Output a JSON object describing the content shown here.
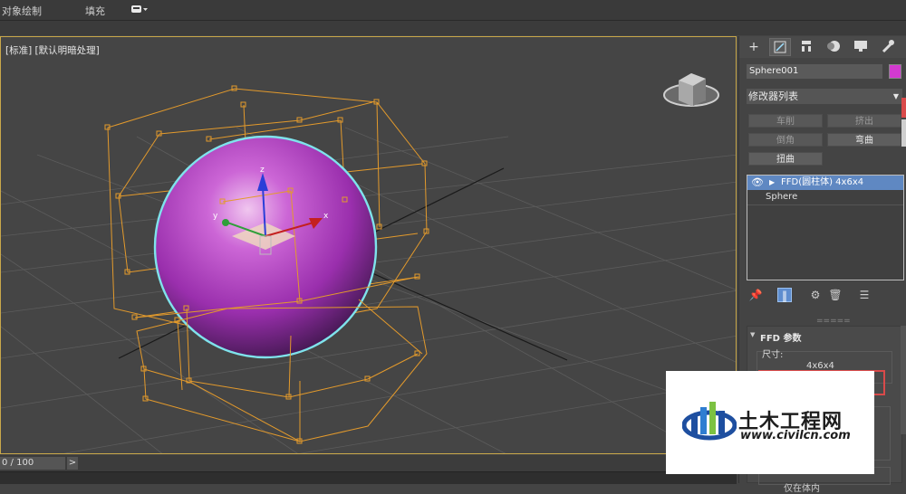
{
  "menubar": {
    "object_paint": "对象绘制",
    "fill": "填充"
  },
  "viewport": {
    "label": "[标准] [默认明暗处理]",
    "axis_x": "x",
    "axis_y": "y",
    "axis_z": "z"
  },
  "timeline": {
    "frame": "0 / 100",
    "next": ">"
  },
  "command_panel": {
    "tabs": [
      "create-tab",
      "modify-tab",
      "hierarchy-tab",
      "motion-tab",
      "display-tab",
      "utilities-tab"
    ],
    "object_name": "Sphere001",
    "object_color": "#d23ad0",
    "modifier_list": "修改器列表",
    "modifier_buttons": {
      "lathe": "车削",
      "extrude": "挤出",
      "chamfer": "倒角",
      "bend": "弯曲",
      "twist": "扭曲"
    },
    "stack": {
      "ffd": "FFD(圆柱体) 4x6x4",
      "base": "Sphere"
    },
    "rollout": {
      "title": "FFD 参数",
      "dimensions_label": "尺寸:",
      "dimensions_value": "4x6x4",
      "radio_partial": "仅在体内"
    }
  },
  "watermark": {
    "title": "土木工程网",
    "url": "www.civilcn.com"
  },
  "colors": {
    "lattice": "#e39a2c",
    "sphere": "#b548c4",
    "selection": "#7fe3ec",
    "highlight": "#d94a4a",
    "active_tab": "#5e8dcf"
  }
}
